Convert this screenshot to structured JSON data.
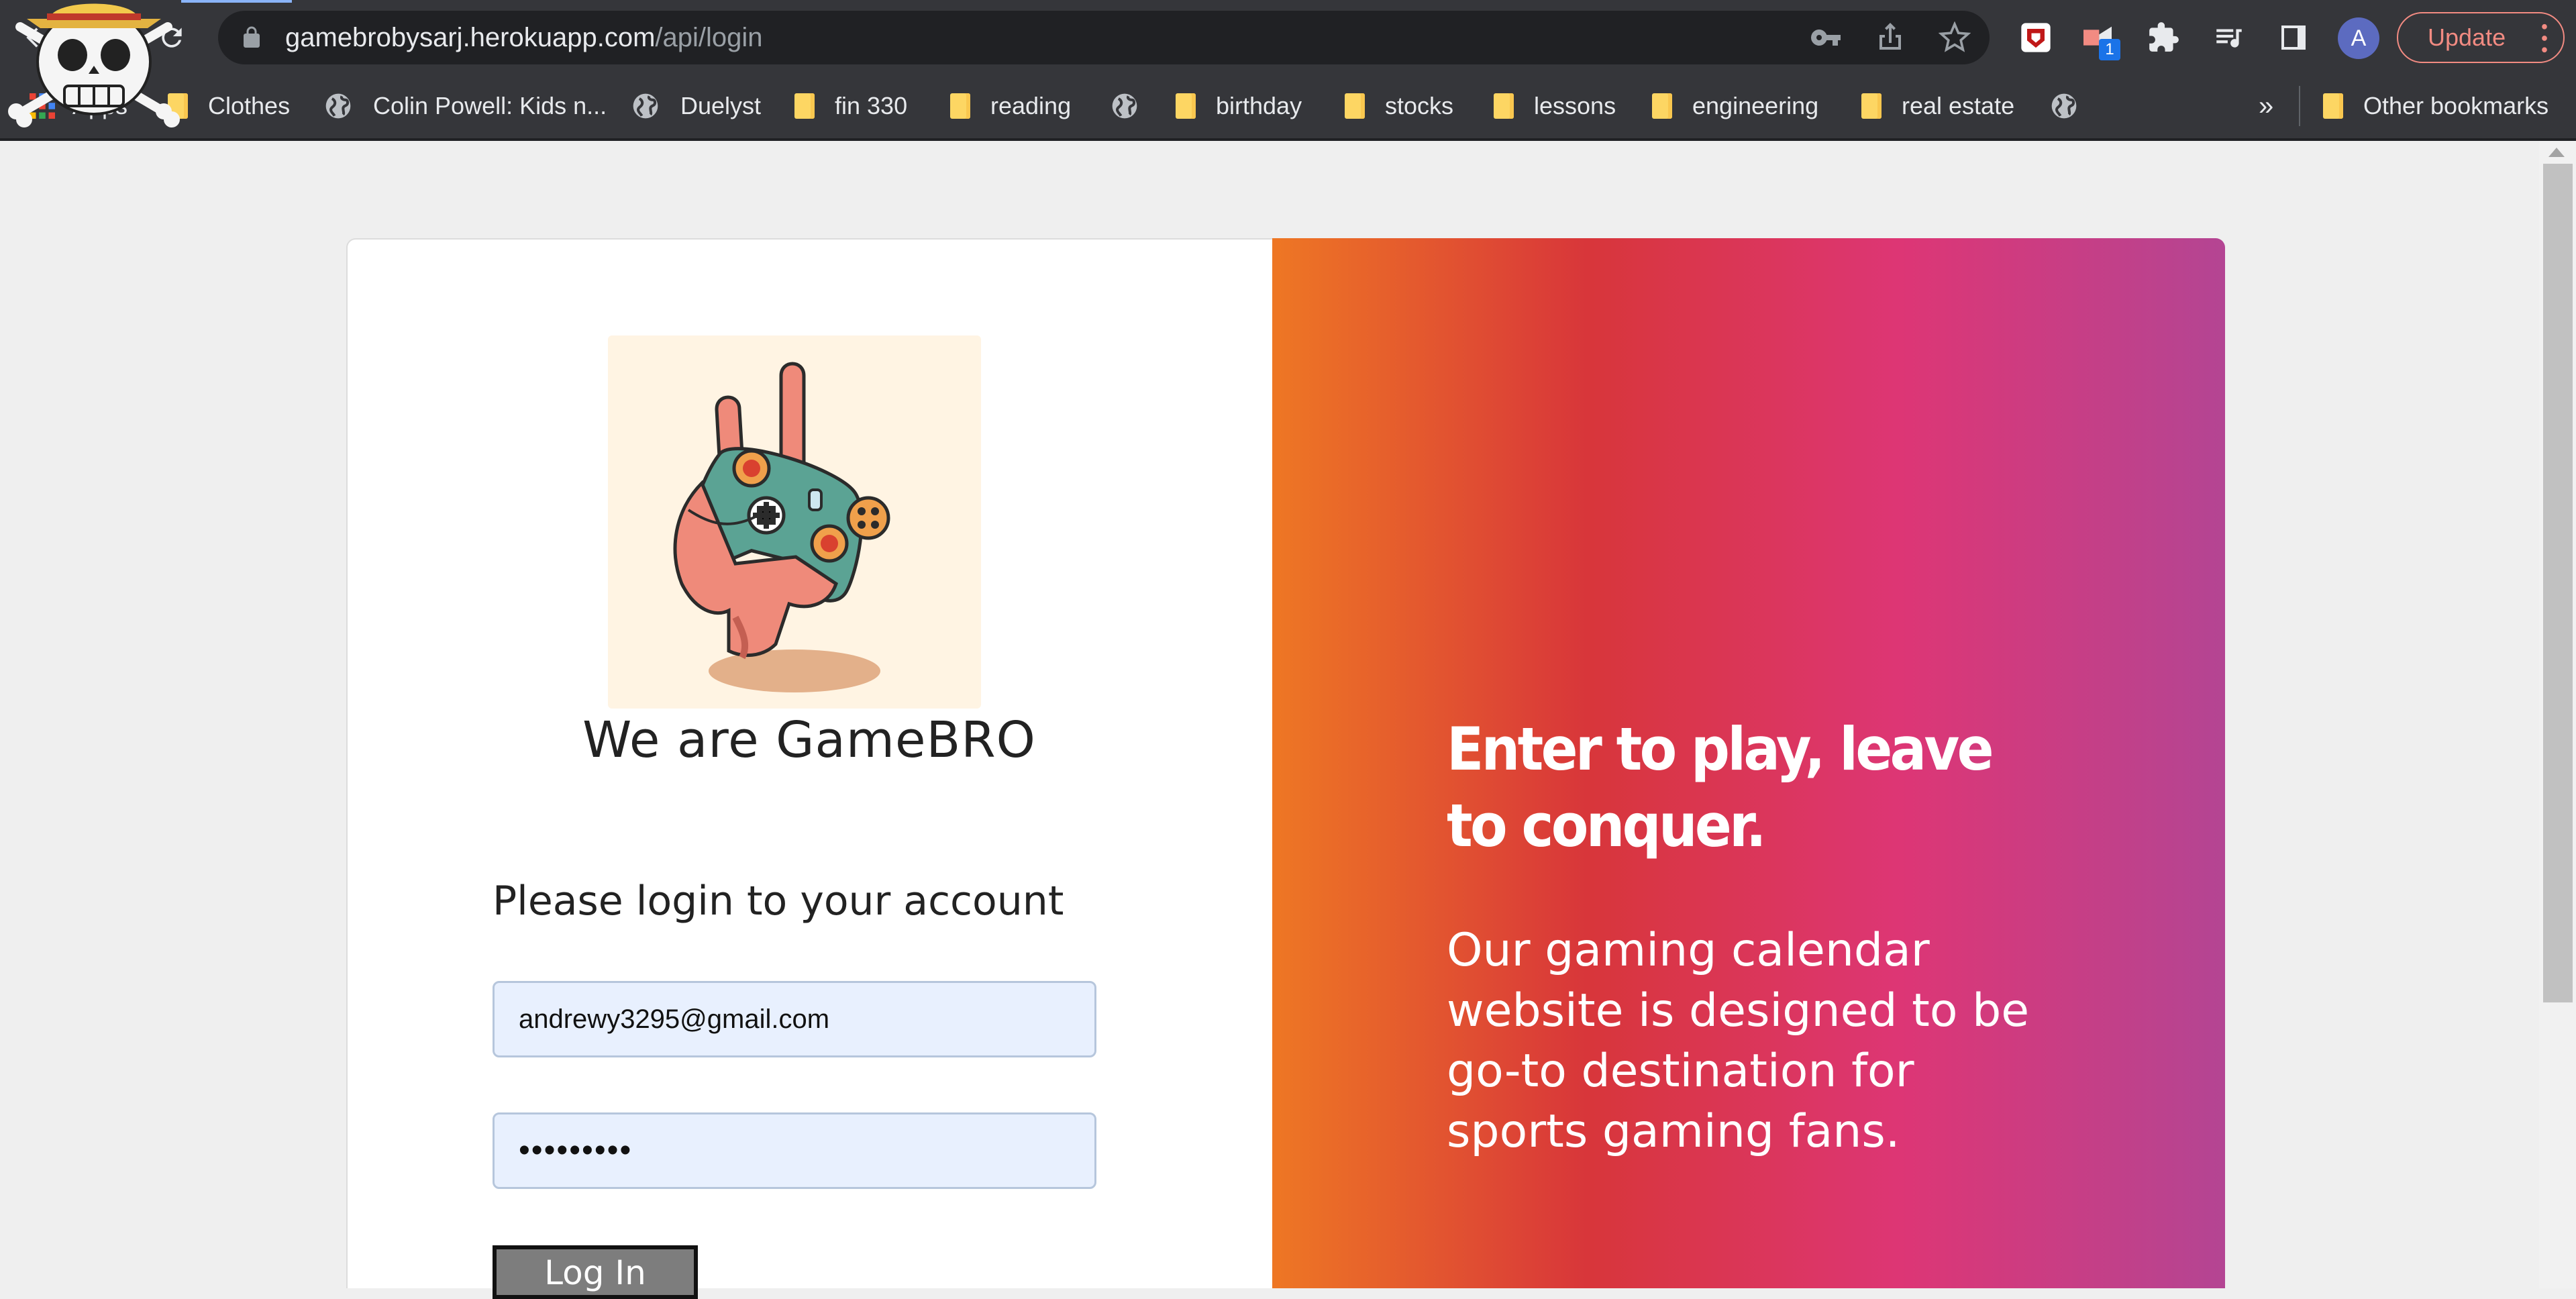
{
  "browser": {
    "url_host": "gamebrobysarj.herokuapp.com",
    "url_path": "/api/login",
    "avatar_letter": "A",
    "update_label": "Update",
    "extension_badge": "1",
    "bookmarks": [
      {
        "label": "Apps",
        "icon": "apps-grid-icon"
      },
      {
        "label": "Clothes",
        "icon": "folder-icon"
      },
      {
        "label": "Colin Powell: Kids n...",
        "icon": "globe-icon"
      },
      {
        "label": "Duelyst",
        "icon": "globe-icon"
      },
      {
        "label": "fin 330",
        "icon": "folder-icon"
      },
      {
        "label": "reading",
        "icon": "folder-icon"
      },
      {
        "label": "",
        "icon": "globe-icon"
      },
      {
        "label": "birthday",
        "icon": "folder-icon"
      },
      {
        "label": "stocks",
        "icon": "folder-icon"
      },
      {
        "label": "lessons",
        "icon": "folder-icon"
      },
      {
        "label": "engineering",
        "icon": "folder-icon"
      },
      {
        "label": "real estate",
        "icon": "folder-icon"
      },
      {
        "label": "",
        "icon": "globe-icon"
      }
    ],
    "overflow_label": "»",
    "other_bookmarks": "Other bookmarks"
  },
  "page": {
    "brand": "We are GameBRO",
    "login_title": "Please login to your account",
    "email_value": "andrewy3295@gmail.com",
    "password_mask": "•••••••••",
    "login_button": "Log In",
    "slogan": "Enter to play, leave to conquer.",
    "description": "Our gaming calendar website is designed to be go-to destination for sports gaming fans."
  },
  "colors": {
    "gradient": [
      "#ee7724",
      "#d8363a",
      "#dd3675",
      "#b44593"
    ],
    "chrome_bg": "#35363a",
    "input_bg": "#e8f0fe"
  }
}
